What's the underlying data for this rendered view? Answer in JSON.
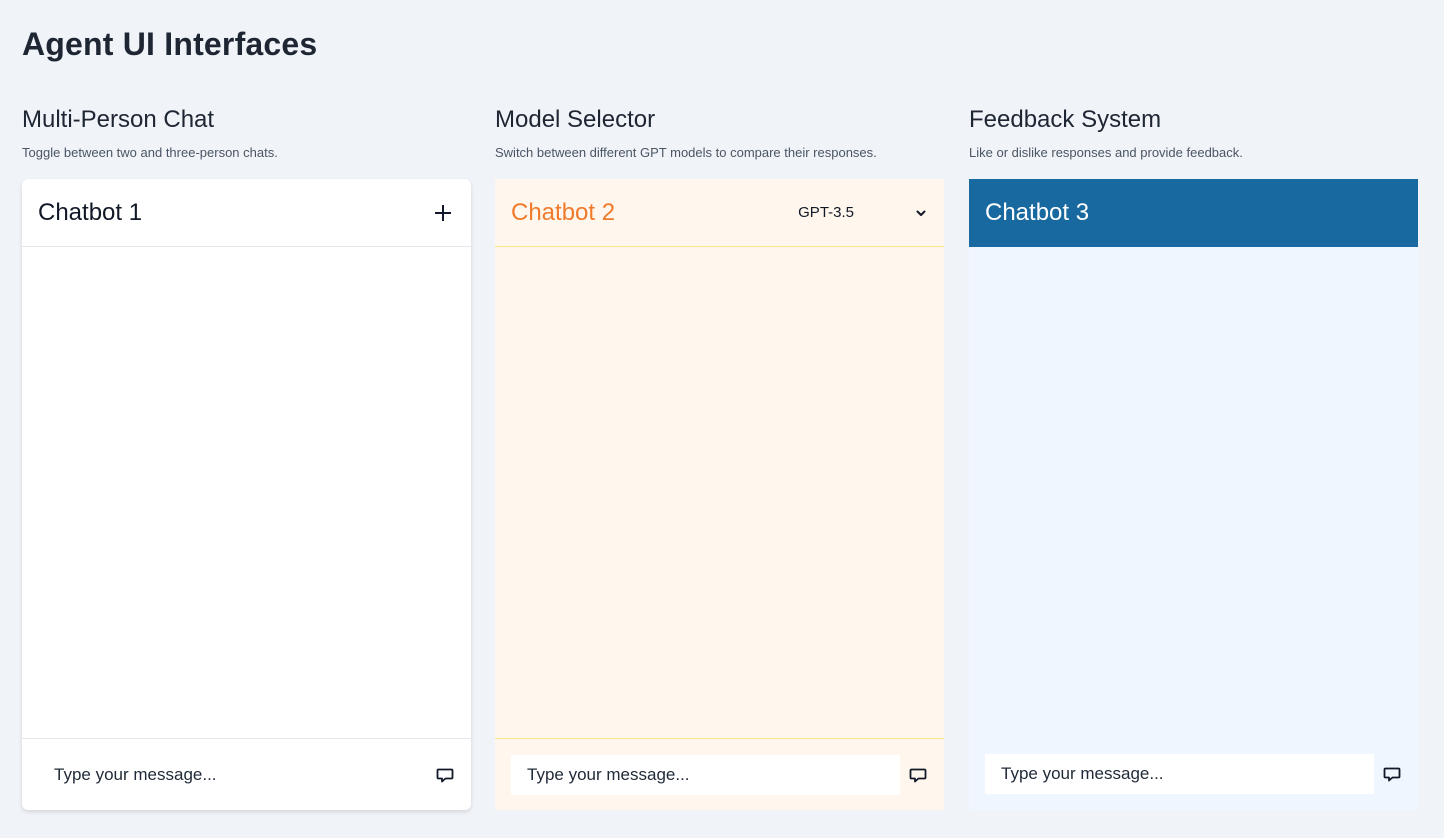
{
  "page": {
    "title": "Agent UI Interfaces"
  },
  "sections": [
    {
      "title": "Multi-Person Chat",
      "description": "Toggle between two and three-person chats.",
      "chatbot": {
        "name": "Chatbot 1",
        "action_icon": "plus-icon",
        "input_placeholder": "Type your message...",
        "send_icon": "message-icon"
      }
    },
    {
      "title": "Model Selector",
      "description": "Switch between different GPT models to compare their responses.",
      "chatbot": {
        "name": "Chatbot 2",
        "model": "GPT-3.5",
        "dropdown_icon": "chevron-down-icon",
        "input_placeholder": "Type your message...",
        "send_icon": "message-icon"
      }
    },
    {
      "title": "Feedback System",
      "description": "Like or dislike responses and provide feedback.",
      "chatbot": {
        "name": "Chatbot 3",
        "input_placeholder": "Type your message...",
        "send_icon": "message-icon"
      }
    }
  ],
  "colors": {
    "background": "#f0f3f8",
    "chatbot2_accent": "#f07a2c",
    "chatbot2_bg": "#fff7ed",
    "chatbot3_header": "#17699f",
    "chatbot3_bg": "#eff6ff"
  }
}
